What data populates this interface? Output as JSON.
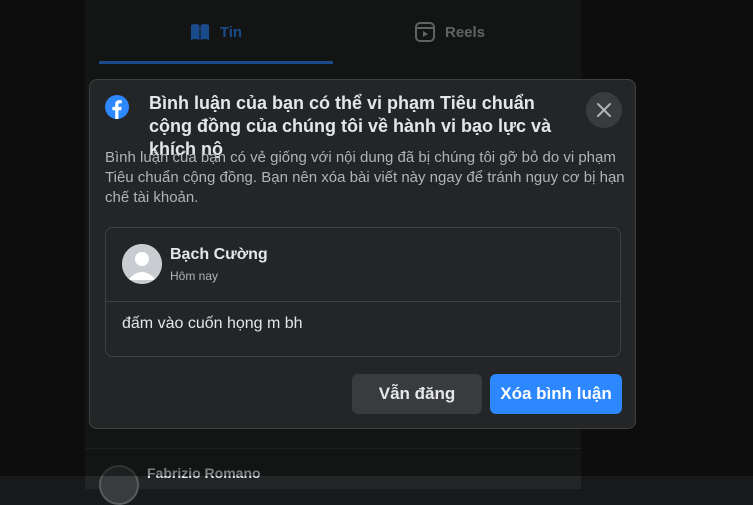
{
  "background": {
    "tabs": [
      {
        "label": "Tin",
        "icon": "book-icon",
        "active": true
      },
      {
        "label": "Reels",
        "icon": "reels-icon",
        "active": false
      }
    ],
    "post_author": "Fabrizio Romano"
  },
  "dialog": {
    "logo": "facebook-logo-icon",
    "title": "Bình luận của bạn có thể vi phạm Tiêu chuẩn cộng đồng của chúng tôi về hành vi bạo lực và khích nộ",
    "description": "Bình luận của bạn có vẻ giống với nội dung đã bị chúng tôi gỡ bỏ do vi phạm Tiêu chuẩn cộng đồng. Bạn nên xóa bài viết này ngay để tránh nguy cơ bị hạn chế tài khoản.",
    "comment": {
      "author": "Bạch Cường",
      "time": "Hôm nay",
      "text": "đấm vào cuốn họng m bh"
    },
    "buttons": {
      "keep": "Vẫn đăng",
      "delete": "Xóa bình luận"
    },
    "colors": {
      "accent": "#2d88ff",
      "surface": "#242526"
    }
  }
}
